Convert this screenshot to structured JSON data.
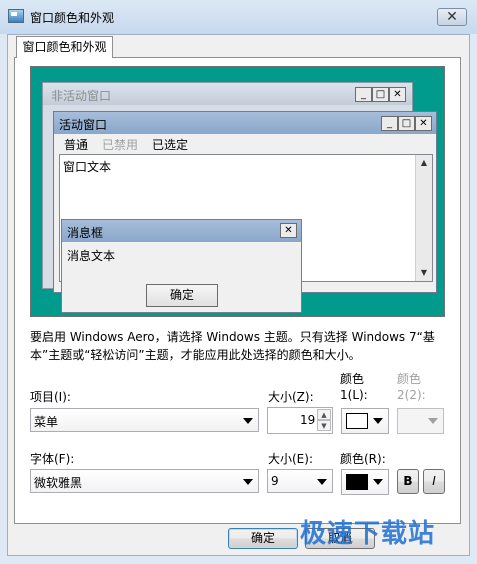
{
  "window": {
    "title": "窗口颜色和外观",
    "close_label": "✕"
  },
  "tab": {
    "label": "窗口颜色和外观"
  },
  "preview": {
    "inactive_title": "非活动窗口",
    "active_title": "活动窗口",
    "caption_buttons": [
      "_",
      "□",
      "✕"
    ],
    "menu": {
      "normal": "普通",
      "disabled": "已禁用",
      "selected": "已选定"
    },
    "window_text": "窗口文本",
    "msgbox_title": "消息框",
    "msgbox_close": "✕",
    "msgbox_text": "消息文本",
    "msgbox_ok": "确定",
    "scroll_up": "▲",
    "scroll_down": "▼"
  },
  "note": "要启用 Windows Aero，请选择 Windows 主题。只有选择 Windows 7“基本”主题或“轻松访问”主题，才能应用此处选择的颜色和大小。",
  "item": {
    "label": "项目(I):",
    "value": "菜单"
  },
  "size1": {
    "label": "大小(Z):",
    "value": "19",
    "spin_up": "▲",
    "spin_down": "▼"
  },
  "color1": {
    "label_line1": "颜色",
    "label_line2": "1(L):",
    "swatch": "#ffffff"
  },
  "color2": {
    "label_line1": "颜色",
    "label_line2": "2(2):"
  },
  "font": {
    "label": "字体(F):",
    "value": "微软雅黑"
  },
  "size2": {
    "label": "大小(E):",
    "value": "9"
  },
  "colorR": {
    "label": "颜色(R):",
    "swatch": "#000000"
  },
  "bold_label": "B",
  "italic_label": "I",
  "buttons": {
    "ok": "确定",
    "cancel": "取消"
  },
  "watermark": "极速下载站",
  "colors": {
    "desktop": "#009b8d",
    "active_title": "#8aa6c9",
    "inactive_title": "#c3ccd8"
  }
}
